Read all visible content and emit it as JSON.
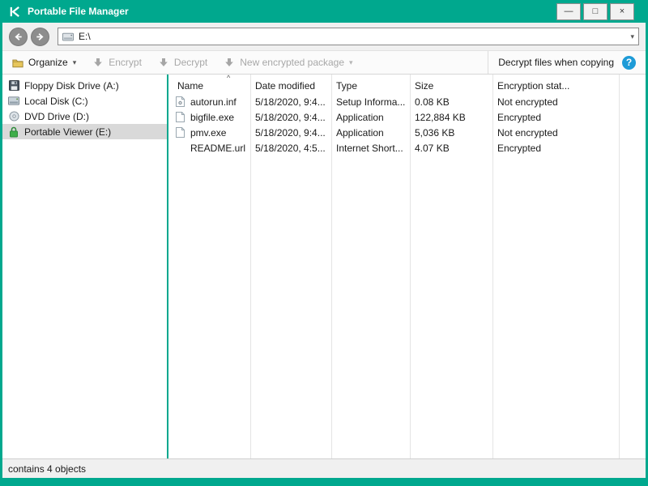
{
  "colors": {
    "accent": "#00a88e",
    "help_blue": "#1e9bd7",
    "lock_green": "#3fae49"
  },
  "window": {
    "title": "Portable File Manager",
    "minimize_glyph": "—",
    "maximize_glyph": "□",
    "close_glyph": "×"
  },
  "navbar": {
    "back_glyph": "←",
    "forward_glyph": "→",
    "address": "E:\\",
    "dropdown_glyph": "▾"
  },
  "toolbar": {
    "organize_label": "Organize",
    "chevron_glyph": "▾",
    "encrypt_label": "Encrypt",
    "decrypt_label": "Decrypt",
    "new_package_label": "New encrypted package",
    "decrypt_copy_label": "Decrypt files when copying",
    "help_glyph": "?"
  },
  "sidebar": {
    "items": [
      {
        "label": "Floppy Disk Drive (A:)",
        "icon": "floppy-drive-icon",
        "selected": false
      },
      {
        "label": "Local Disk (C:)",
        "icon": "hard-disk-icon",
        "selected": false
      },
      {
        "label": "DVD Drive (D:)",
        "icon": "dvd-drive-icon",
        "selected": false
      },
      {
        "label": "Portable Viewer (E:)",
        "icon": "green-lock-icon",
        "selected": true
      }
    ]
  },
  "filelist": {
    "sort_glyph": "^",
    "columns": [
      "Name",
      "Date modified",
      "Type",
      "Size",
      "Encryption stat..."
    ],
    "rows": [
      {
        "name": "autorun.inf",
        "icon": "setup-file-icon",
        "date": "5/18/2020, 9:4...",
        "type": "Setup Informa...",
        "size": "0.08 KB",
        "encryption": "Not encrypted"
      },
      {
        "name": "bigfile.exe",
        "icon": "file-icon",
        "date": "5/18/2020, 9:4...",
        "type": "Application",
        "size": "122,884 KB",
        "encryption": "Encrypted"
      },
      {
        "name": "pmv.exe",
        "icon": "file-icon",
        "date": "5/18/2020, 9:4...",
        "type": "Application",
        "size": "5,036 KB",
        "encryption": "Not encrypted"
      },
      {
        "name": "README.url",
        "icon": "none",
        "date": "5/18/2020, 4:5...",
        "type": "Internet Short...",
        "size": "4.07 KB",
        "encryption": "Encrypted"
      }
    ]
  },
  "statusbar": {
    "text": "contains 4 objects"
  }
}
